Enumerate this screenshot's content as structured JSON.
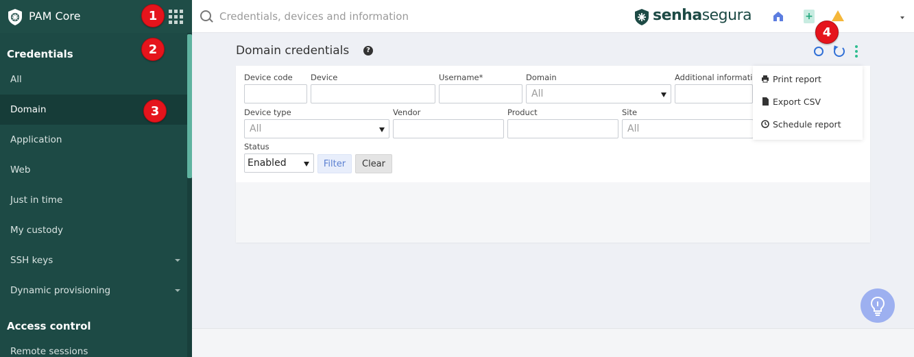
{
  "app": {
    "title": "PAM Core"
  },
  "sidebar": {
    "sections": [
      {
        "title": "Credentials"
      },
      {
        "title": "Access control"
      }
    ],
    "items": [
      {
        "label": "All"
      },
      {
        "label": "Domain"
      },
      {
        "label": "Application"
      },
      {
        "label": "Web"
      },
      {
        "label": "Just in time"
      },
      {
        "label": "My custody"
      },
      {
        "label": "SSH keys"
      },
      {
        "label": "Dynamic provisioning"
      },
      {
        "label": "Remote sessions"
      }
    ]
  },
  "topbar": {
    "search_placeholder": "Credentials, devices and information",
    "brand_bold": "senha",
    "brand_light": "segura"
  },
  "page": {
    "title": "Domain credentials",
    "help_icon": "?"
  },
  "filters": {
    "device_code_label": "Device code",
    "device_label": "Device",
    "username_label": "Username*",
    "domain_label": "Domain",
    "domain_value": "All",
    "additional_info_label": "Additional information",
    "device_type_label": "Device type",
    "device_type_value": "All",
    "vendor_label": "Vendor",
    "product_label": "Product",
    "site_label": "Site",
    "site_value": "All",
    "status_label": "Status",
    "status_value": "Enabled",
    "filter_button": "Filter",
    "clear_button": "Clear"
  },
  "menu": {
    "items": [
      {
        "label": "Print report",
        "icon": "printer-icon"
      },
      {
        "label": "Export CSV",
        "icon": "file-icon"
      },
      {
        "label": "Schedule report",
        "icon": "clock-icon"
      }
    ]
  },
  "markers": [
    "1",
    "2",
    "3",
    "4"
  ],
  "colors": {
    "sidebar": "#1d4a45",
    "accent_blue": "#2f6fd6",
    "accent_green": "#2ebd8f",
    "marker_red": "#e5141c"
  }
}
